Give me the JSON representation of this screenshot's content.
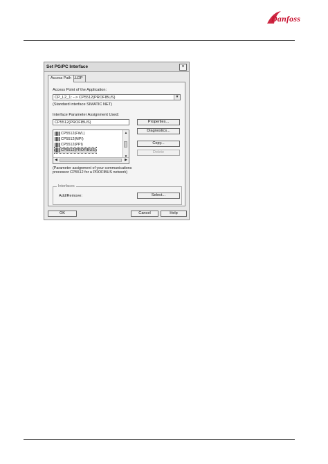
{
  "logo": {
    "text": "Danfoss"
  },
  "dialog": {
    "title": "Set PG/PC Interface",
    "close_glyph": "×",
    "tabs": [
      {
        "label": "Access Path"
      },
      {
        "label": "LLDP"
      }
    ],
    "access_point_label": "Access Point of the Application:",
    "access_point_value": "CP_L2_1:        --> CP5512(PROFIBUS)",
    "access_point_note": "(Standard interface SIMATIC NET)",
    "param_label": "Interface Parameter Assignment Used:",
    "param_value": "CP5512(PROFIBUS)",
    "list_items": [
      {
        "label": "CP5512(FWL)"
      },
      {
        "label": "CP5512(MPI)"
      },
      {
        "label": "CP5512(PPI)"
      },
      {
        "label": "CP5512(PROFIBUS)"
      }
    ],
    "buttons": {
      "properties": "Properties...",
      "diagnostics": "Diagnostics...",
      "copy": "Copy...",
      "delete": "Delete"
    },
    "description": "(Parameter assignment of your communications processor CP5512 for a PROFIBUS network)",
    "interfaces_group": "Interfaces",
    "add_remove_label": "Add/Remove:",
    "select_button": "Select...",
    "ok": "OK",
    "cancel": "Cancel",
    "help": "Help"
  }
}
